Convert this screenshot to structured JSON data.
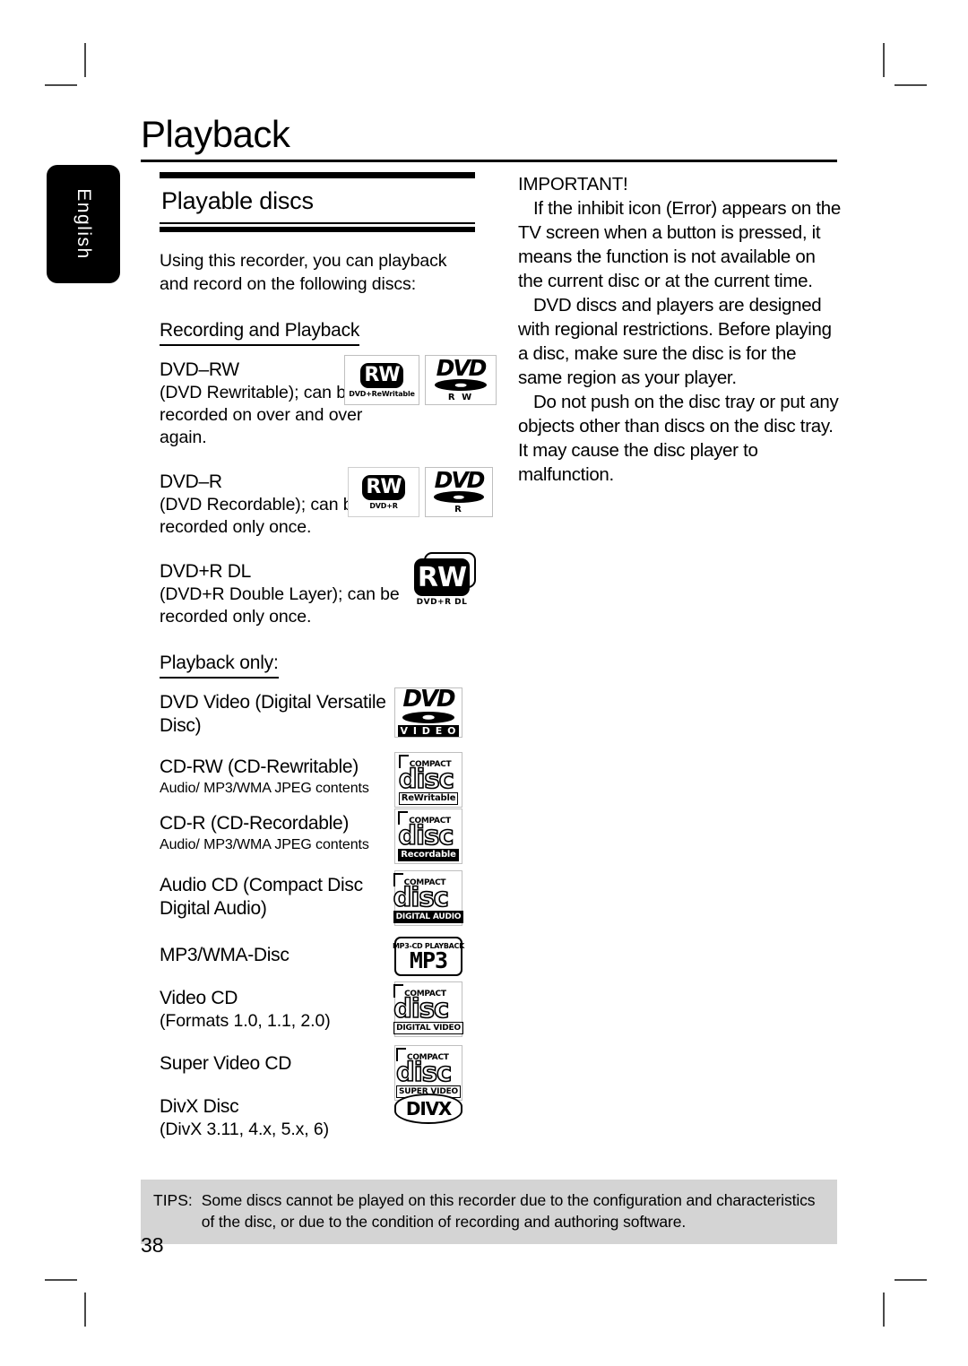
{
  "page": {
    "title": "Playback",
    "number": "38",
    "language_tab": "English"
  },
  "left_column": {
    "section_heading": "Playable discs",
    "intro": "Using this recorder, you can playback and record on the following discs:",
    "subheads": {
      "recording_playback": "Recording and Playback ",
      "playback_only": "Playback only:"
    },
    "recording_discs": [
      {
        "name": "DVD–RW",
        "desc": "(DVD Rewritable); can be recorded on over and over again.",
        "logos": [
          "rw-dvd-plus-rewritable-logo",
          "dvd-rw-logo"
        ],
        "logo_labels": [
          "DVD+ReWritable",
          "R W"
        ]
      },
      {
        "name": "DVD–R",
        "desc": "(DVD Recordable); can be recorded only once.",
        "logos": [
          "rw-dvd-plus-r-logo",
          "dvd-r-logo"
        ],
        "logo_labels": [
          "DVD+R",
          "R"
        ]
      },
      {
        "name": "DVD+R DL",
        "desc": "(DVD+R Double Layer); can be recorded only once.",
        "logos": [
          "rw-dvd-plus-r-dl-logo"
        ],
        "logo_labels": [
          "DVD+R DL"
        ]
      }
    ],
    "playback_discs": [
      {
        "name": "DVD Video  (Digital Versatile",
        "name2": "Disc)",
        "desc": "",
        "logo": "dvd-video-logo",
        "logo_word": "DVD",
        "logo_sub": "V I D E O"
      },
      {
        "name": "CD-RW  (CD-Rewritable)",
        "desc": "Audio/ MP3/WMA JPEG contents",
        "logo": "compact-disc-rewritable-logo",
        "logo_top": "COMPACT",
        "logo_word": "disc",
        "logo_tag": "ReWritable"
      },
      {
        "name": "CD-R (CD-Recordable)",
        "desc": "Audio/ MP3/WMA JPEG contents",
        "logo": "compact-disc-recordable-logo",
        "logo_top": "COMPACT",
        "logo_word": "disc",
        "logo_tag": "Recordable"
      },
      {
        "name": "Audio CD  (Compact Disc",
        "name2": "Digital Audio)",
        "desc": "",
        "logo": "compact-disc-digital-audio-logo",
        "logo_top": "COMPACT",
        "logo_word": "disc",
        "logo_tag": "DIGITAL AUDIO"
      },
      {
        "name": "MP3/WMA-Disc",
        "desc": "",
        "logo": "mp3-cd-playback-logo",
        "logo_top": "MP3-CD PLAYBACK",
        "logo_word": "MP3"
      },
      {
        "name": "Video CD",
        "desc": "(Formats 1.0, 1.1, 2.0)",
        "logo": "compact-disc-digital-video-logo",
        "logo_top": "COMPACT",
        "logo_word": "disc",
        "logo_tag": "DIGITAL VIDEO"
      },
      {
        "name": "Super Video CD",
        "desc": "",
        "logo": "compact-disc-super-video-logo",
        "logo_top": "COMPACT",
        "logo_word": "disc",
        "logo_tag": "SUPER VIDEO"
      },
      {
        "name": "DivX Disc",
        "desc": "(DivX 3.11, 4.x, 5.x, 6)",
        "logo": "divx-logo",
        "logo_word": "DIVX"
      }
    ]
  },
  "right_column": {
    "important_title": "IMPORTANT!",
    "paragraphs": [
      "If the inhibit icon (Error) appears on the TV screen when a button is pressed, it means the function is not available on the current disc or at the current time.",
      "DVD discs and players are designed with regional restrictions. Before playing a disc, make sure the disc is for the same region as your player.",
      "Do not push on the disc tray or put any objects other than discs on the disc tray. It may cause the disc player to malfunction."
    ]
  },
  "tips": {
    "label": "TIPS:",
    "text": "Some discs cannot be played on this recorder due to the configuration and characteristics of the disc, or due to the condition of recording and authoring software."
  },
  "colors": {
    "tips_background": "#d4d4d4",
    "tab_background": "#000000",
    "text": "#000000"
  }
}
